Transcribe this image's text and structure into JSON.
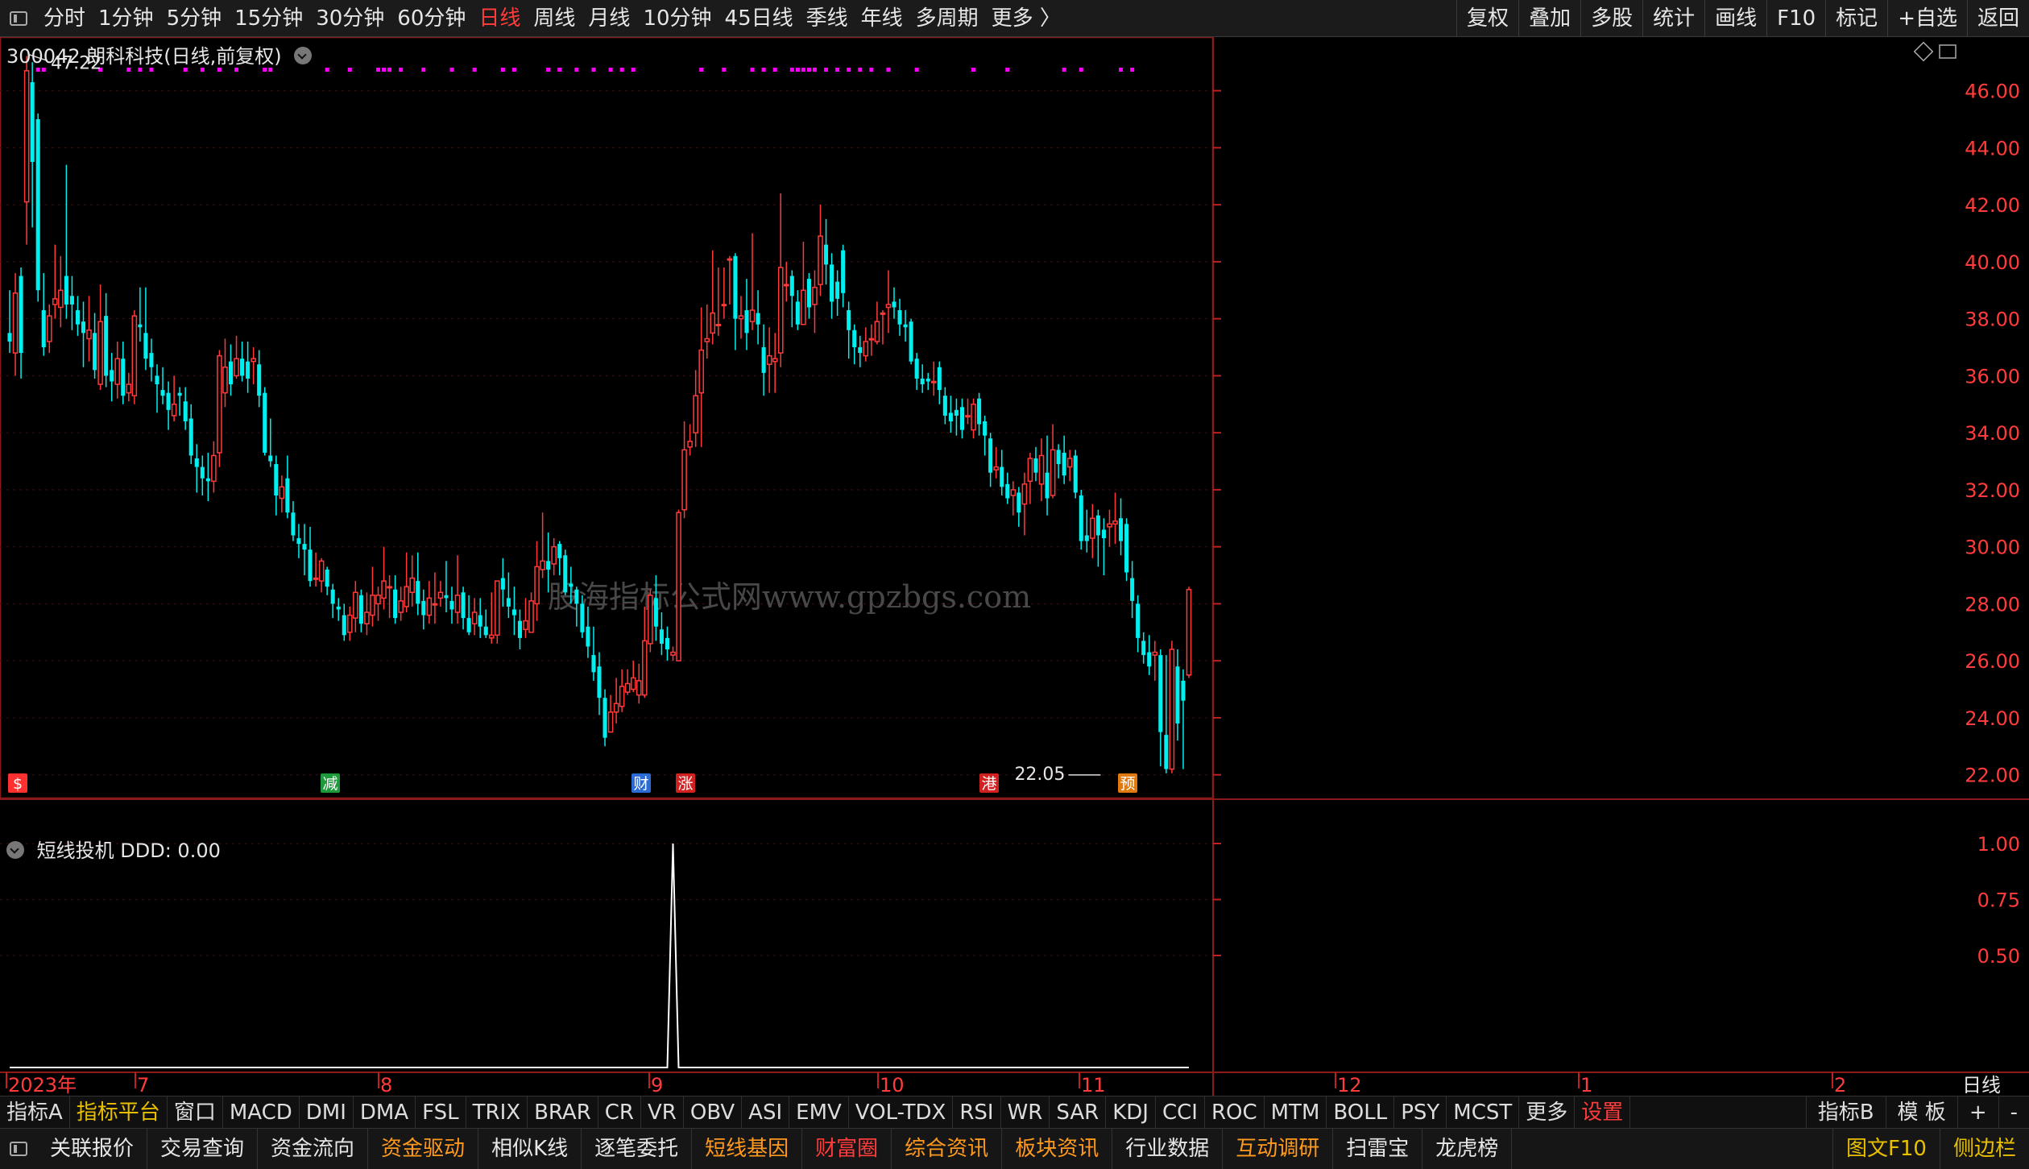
{
  "toolbar": {
    "periods": [
      "分时",
      "1分钟",
      "5分钟",
      "15分钟",
      "30分钟",
      "60分钟",
      "日线",
      "周线",
      "月线",
      "10分钟",
      "45日线",
      "季线",
      "年线",
      "多周期",
      "更多 〉"
    ],
    "active_period": "日线",
    "right_buttons": [
      "复权",
      "叠加",
      "多股",
      "统计",
      "画线",
      "F10",
      "标记",
      "+自选",
      "返回"
    ]
  },
  "chart": {
    "title": "300042 朗科科技(日线,前复权)",
    "high_label": "47.22",
    "low_label": "22.05",
    "watermark": "股海指标公式网www.gpzbgs.com",
    "price_axis": [
      "46.00",
      "44.00",
      "42.00",
      "40.00",
      "38.00",
      "36.00",
      "34.00",
      "32.00",
      "30.00",
      "28.00",
      "26.00",
      "24.00",
      "22.00"
    ],
    "event_markers": [
      {
        "label": "$",
        "color": "#ff3030"
      },
      {
        "label": "减",
        "color": "#1e9a3c"
      },
      {
        "label": "财",
        "color": "#2a6bd6"
      },
      {
        "label": "涨",
        "color": "#d02020"
      },
      {
        "label": "港",
        "color": "#d02020"
      },
      {
        "label": "预",
        "color": "#e07a10"
      }
    ],
    "up_color": "#ff3a3a",
    "down_color": "#00f0f0",
    "dots_color": "#ff00ff"
  },
  "indicator": {
    "title": "短线投机 DDD: 0.00",
    "axis": [
      "1.00",
      "0.75",
      "0.50"
    ]
  },
  "time_axis": {
    "labels": [
      "2023年",
      "7",
      "8",
      "9",
      "10",
      "11",
      "12",
      "1",
      "2"
    ],
    "period_label": "日线"
  },
  "indicator_tabs": {
    "items": [
      "指标A",
      "指标平台",
      "窗口",
      "MACD",
      "DMI",
      "DMA",
      "FSL",
      "TRIX",
      "BRAR",
      "CR",
      "VR",
      "OBV",
      "ASI",
      "EMV",
      "VOL-TDX",
      "RSI",
      "WR",
      "SAR",
      "KDJ",
      "CCI",
      "ROC",
      "MTM",
      "BOLL",
      "PSY",
      "MCST",
      "更多",
      "设置"
    ],
    "highlight_yellow": "指标平台",
    "highlight_red": "设置",
    "right": [
      "指标B",
      "模 板",
      "+",
      "-"
    ]
  },
  "bottom_bar": {
    "items": [
      "关联报价",
      "交易查询",
      "资金流向",
      "资金驱动",
      "相似K线",
      "逐笔委托",
      "短线基因",
      "财富圈",
      "综合资讯",
      "板块资讯",
      "行业数据",
      "互动调研",
      "扫雷宝",
      "龙虎榜"
    ],
    "orange": [
      "资金驱动",
      "短线基因",
      "综合资讯",
      "板块资讯",
      "互动调研"
    ],
    "red": [
      "财富圈"
    ],
    "right": [
      "图文F10",
      "侧边栏"
    ]
  },
  "chart_data": {
    "type": "candlestick",
    "price_range": [
      21.2,
      47.6
    ],
    "candles": [
      [
        37.5,
        37.2,
        39.0,
        36.8
      ],
      [
        36.8,
        38.9,
        39.6,
        36.0
      ],
      [
        39.5,
        36.8,
        39.8,
        35.9
      ],
      [
        42.1,
        46.7,
        47.22,
        40.6
      ],
      [
        46.3,
        43.5,
        47.0,
        41.2
      ],
      [
        45.0,
        39.0,
        45.2,
        38.6
      ],
      [
        38.3,
        37.0,
        39.6,
        36.7
      ],
      [
        37.2,
        38.1,
        38.5,
        36.8
      ],
      [
        38.5,
        38.7,
        40.6,
        38.0
      ],
      [
        38.4,
        39.0,
        40.2,
        37.7
      ],
      [
        39.5,
        38.5,
        43.4,
        38.0
      ],
      [
        38.8,
        38.5,
        39.5,
        37.6
      ],
      [
        38.3,
        37.8,
        38.8,
        37.4
      ],
      [
        37.9,
        37.5,
        38.6,
        36.3
      ],
      [
        37.3,
        37.6,
        38.8,
        36.5
      ],
      [
        37.5,
        36.2,
        38.2,
        35.9
      ],
      [
        35.7,
        37.9,
        39.2,
        35.5
      ],
      [
        38.1,
        36.0,
        38.9,
        35.6
      ],
      [
        36.2,
        35.8,
        36.8,
        35.1
      ],
      [
        35.7,
        36.6,
        37.2,
        35.2
      ],
      [
        36.6,
        35.3,
        37.2,
        35.0
      ],
      [
        35.4,
        35.7,
        36.1,
        35.1
      ],
      [
        35.3,
        38.1,
        38.3,
        35.0
      ],
      [
        37.8,
        37.7,
        39.1,
        37.2
      ],
      [
        37.5,
        36.6,
        39.1,
        36.2
      ],
      [
        36.8,
        36.3,
        37.3,
        35.8
      ],
      [
        36.0,
        35.7,
        36.4,
        34.7
      ],
      [
        35.5,
        35.3,
        36.3,
        35.0
      ],
      [
        35.4,
        34.8,
        35.8,
        34.1
      ],
      [
        34.6,
        35.0,
        36.0,
        34.4
      ],
      [
        35.4,
        35.3,
        35.6,
        34.6
      ],
      [
        35.1,
        34.4,
        35.6,
        34.1
      ],
      [
        34.5,
        33.2,
        35.0,
        32.9
      ],
      [
        33.1,
        32.8,
        33.6,
        31.9
      ],
      [
        32.8,
        32.4,
        33.2,
        31.8
      ],
      [
        32.4,
        32.3,
        33.3,
        31.6
      ],
      [
        32.3,
        33.2,
        33.7,
        31.9
      ],
      [
        33.3,
        36.7,
        36.9,
        32.8
      ],
      [
        35.4,
        36.3,
        37.3,
        34.9
      ],
      [
        36.5,
        35.7,
        37.1,
        35.3
      ],
      [
        36.0,
        36.6,
        37.4,
        35.9
      ],
      [
        36.6,
        36.0,
        37.2,
        35.8
      ],
      [
        36.5,
        35.9,
        37.2,
        35.4
      ],
      [
        36.5,
        36.6,
        37.0,
        35.7
      ],
      [
        36.4,
        35.3,
        36.9,
        34.9
      ],
      [
        35.4,
        33.3,
        35.6,
        33.2
      ],
      [
        33.2,
        33.0,
        34.5,
        32.8
      ],
      [
        32.9,
        31.8,
        33.2,
        31.1
      ],
      [
        31.7,
        32.1,
        32.5,
        31.2
      ],
      [
        32.4,
        31.2,
        33.2,
        31.0
      ],
      [
        31.2,
        30.4,
        31.6,
        30.2
      ],
      [
        30.3,
        30.1,
        30.8,
        29.6
      ],
      [
        30.1,
        29.9,
        30.8,
        29.0
      ],
      [
        29.9,
        28.8,
        30.7,
        28.6
      ],
      [
        28.9,
        28.9,
        29.8,
        28.6
      ],
      [
        28.8,
        29.5,
        29.6,
        28.4
      ],
      [
        29.2,
        28.6,
        29.3,
        28.3
      ],
      [
        28.5,
        28.0,
        28.7,
        27.5
      ],
      [
        27.9,
        27.8,
        28.2,
        27.4
      ],
      [
        27.6,
        26.9,
        28.0,
        26.7
      ],
      [
        27.0,
        27.6,
        27.9,
        26.7
      ],
      [
        27.5,
        28.4,
        28.8,
        27.0
      ],
      [
        28.3,
        27.3,
        28.5,
        27.0
      ],
      [
        27.3,
        27.7,
        28.4,
        26.9
      ],
      [
        27.6,
        28.3,
        29.3,
        27.2
      ],
      [
        28.0,
        28.3,
        28.6,
        27.4
      ],
      [
        28.2,
        28.8,
        30.0,
        27.8
      ],
      [
        28.6,
        28.6,
        29.0,
        27.5
      ],
      [
        28.5,
        27.5,
        29.0,
        27.3
      ],
      [
        27.7,
        28.1,
        28.6,
        27.4
      ],
      [
        27.9,
        28.6,
        29.8,
        27.7
      ],
      [
        28.4,
        28.9,
        29.7,
        27.9
      ],
      [
        28.8,
        28.0,
        29.8,
        27.6
      ],
      [
        28.1,
        27.6,
        28.5,
        27.1
      ],
      [
        27.6,
        28.2,
        28.8,
        27.3
      ],
      [
        28.0,
        28.0,
        29.1,
        27.3
      ],
      [
        28.2,
        28.4,
        28.8,
        27.9
      ],
      [
        28.3,
        28.2,
        29.5,
        27.7
      ],
      [
        28.1,
        27.8,
        28.6,
        27.3
      ],
      [
        27.7,
        28.3,
        29.7,
        27.3
      ],
      [
        28.4,
        27.5,
        28.6,
        27.1
      ],
      [
        27.5,
        27.0,
        28.3,
        26.9
      ],
      [
        27.3,
        27.7,
        28.2,
        26.9
      ],
      [
        27.6,
        27.2,
        28.2,
        26.8
      ],
      [
        27.2,
        26.9,
        27.8,
        26.8
      ],
      [
        26.8,
        26.9,
        28.4,
        26.6
      ],
      [
        26.9,
        28.8,
        28.8,
        26.6
      ],
      [
        28.9,
        28.5,
        29.6,
        27.9
      ],
      [
        28.2,
        27.9,
        29.1,
        27.5
      ],
      [
        27.8,
        27.6,
        28.6,
        26.9
      ],
      [
        27.4,
        26.8,
        27.8,
        26.4
      ],
      [
        27.1,
        27.4,
        28.2,
        26.8
      ],
      [
        27.0,
        28.1,
        28.4,
        27.4
      ],
      [
        28.0,
        29.3,
        30.2,
        27.4
      ],
      [
        29.2,
        29.5,
        31.2,
        28.9
      ],
      [
        29.5,
        29.2,
        30.5,
        28.4
      ],
      [
        29.4,
        30.0,
        30.3,
        29.0
      ],
      [
        30.1,
        29.6,
        30.2,
        29.0
      ],
      [
        29.7,
        28.4,
        29.9,
        28.3
      ],
      [
        28.7,
        28.6,
        29.3,
        28.0
      ],
      [
        28.5,
        28.0,
        28.6,
        27.2
      ],
      [
        28.0,
        27.0,
        28.3,
        26.8
      ],
      [
        27.2,
        26.5,
        27.9,
        26.1
      ],
      [
        26.2,
        25.6,
        27.2,
        25.3
      ],
      [
        25.8,
        24.7,
        26.3,
        24.1
      ],
      [
        24.7,
        23.3,
        25.0,
        23.0
      ],
      [
        23.5,
        24.2,
        24.8,
        23.5
      ],
      [
        24.2,
        24.5,
        25.4,
        23.8
      ],
      [
        24.4,
        25.1,
        25.7,
        24.2
      ],
      [
        24.9,
        25.2,
        25.7,
        24.8
      ],
      [
        25.0,
        25.4,
        26.0,
        24.9
      ],
      [
        24.8,
        25.3,
        25.9,
        24.5
      ],
      [
        24.8,
        26.7,
        27.9,
        24.7
      ],
      [
        26.6,
        28.3,
        28.5,
        26.3
      ],
      [
        28.2,
        27.2,
        29.0,
        26.7
      ],
      [
        27.1,
        26.6,
        27.7,
        26.2
      ],
      [
        26.8,
        26.4,
        27.2,
        26.0
      ],
      [
        26.2,
        26.3,
        26.5,
        26.0
      ],
      [
        26.0,
        31.2,
        31.3,
        26.0
      ],
      [
        31.3,
        33.4,
        34.4,
        31.0
      ],
      [
        33.5,
        33.7,
        34.3,
        33.2
      ],
      [
        34.0,
        35.3,
        36.2,
        33.5
      ],
      [
        35.4,
        36.9,
        38.4,
        33.5
      ],
      [
        37.2,
        37.3,
        38.5,
        36.6
      ],
      [
        37.5,
        38.2,
        40.4,
        37.1
      ],
      [
        37.8,
        37.8,
        39.8,
        37.4
      ],
      [
        38.5,
        38.5,
        39.8,
        38.0
      ],
      [
        40.1,
        40.1,
        40.2,
        38.5
      ],
      [
        40.2,
        38.0,
        40.3,
        36.9
      ],
      [
        38.0,
        38.1,
        38.8,
        37.3
      ],
      [
        38.3,
        37.5,
        39.4,
        36.9
      ],
      [
        37.9,
        38.3,
        41.0,
        37.6
      ],
      [
        38.2,
        37.8,
        39.0,
        37.1
      ],
      [
        37.0,
        36.1,
        37.8,
        35.3
      ],
      [
        36.4,
        36.7,
        37.7,
        35.4
      ],
      [
        36.5,
        36.6,
        37.5,
        35.4
      ],
      [
        36.8,
        39.8,
        42.4,
        36.3
      ],
      [
        39.2,
        39.2,
        40.0,
        38.6
      ],
      [
        39.5,
        38.8,
        39.7,
        37.7
      ],
      [
        38.6,
        37.8,
        39.0,
        37.6
      ],
      [
        37.8,
        39.0,
        40.7,
        37.9
      ],
      [
        39.4,
        38.4,
        39.6,
        38.0
      ],
      [
        38.5,
        39.1,
        39.7,
        37.5
      ],
      [
        39.2,
        40.9,
        42.0,
        38.8
      ],
      [
        40.6,
        39.9,
        41.5,
        39.2
      ],
      [
        39.9,
        38.6,
        40.3,
        38.0
      ],
      [
        39.3,
        38.7,
        39.7,
        38.1
      ],
      [
        40.4,
        38.9,
        40.6,
        38.4
      ],
      [
        38.3,
        37.6,
        38.6,
        36.6
      ],
      [
        37.6,
        37.0,
        37.8,
        36.4
      ],
      [
        37.0,
        36.8,
        37.4,
        36.3
      ],
      [
        36.7,
        37.2,
        37.7,
        36.5
      ],
      [
        37.3,
        37.3,
        37.8,
        36.7
      ],
      [
        37.2,
        37.9,
        38.6,
        37.1
      ],
      [
        38.2,
        38.2,
        38.3,
        37.1
      ],
      [
        38.4,
        38.5,
        39.7,
        37.5
      ],
      [
        38.6,
        38.4,
        39.1,
        38.0
      ],
      [
        38.3,
        37.8,
        38.7,
        37.4
      ],
      [
        37.8,
        37.7,
        38.3,
        37.2
      ],
      [
        37.9,
        36.5,
        38.0,
        36.4
      ],
      [
        36.6,
        35.9,
        36.8,
        35.5
      ],
      [
        35.9,
        35.7,
        36.4,
        35.4
      ],
      [
        35.9,
        35.8,
        36.1,
        35.5
      ],
      [
        35.8,
        35.8,
        36.5,
        35.3
      ],
      [
        36.3,
        35.5,
        36.5,
        35.0
      ],
      [
        35.3,
        34.6,
        35.6,
        34.3
      ],
      [
        34.7,
        34.4,
        35.3,
        34.0
      ],
      [
        34.8,
        34.6,
        35.2,
        33.9
      ],
      [
        34.9,
        34.1,
        35.2,
        33.8
      ],
      [
        34.6,
        34.6,
        35.2,
        34.3
      ],
      [
        34.1,
        35.0,
        35.2,
        33.8
      ],
      [
        35.2,
        34.3,
        35.4,
        33.9
      ],
      [
        34.4,
        33.9,
        34.6,
        33.2
      ],
      [
        33.8,
        32.6,
        34.0,
        32.1
      ],
      [
        32.7,
        32.8,
        33.5,
        32.4
      ],
      [
        32.8,
        32.1,
        33.4,
        31.8
      ],
      [
        32.2,
        31.7,
        32.6,
        31.5
      ],
      [
        31.8,
        32.0,
        32.3,
        31.1
      ],
      [
        31.9,
        31.2,
        32.1,
        30.7
      ],
      [
        31.5,
        32.2,
        32.6,
        30.4
      ],
      [
        32.3,
        33.1,
        33.3,
        31.5
      ],
      [
        33.1,
        32.6,
        33.5,
        32.3
      ],
      [
        32.2,
        33.2,
        33.8,
        31.6
      ],
      [
        32.6,
        31.7,
        33.9,
        31.1
      ],
      [
        31.8,
        33.4,
        34.3,
        31.7
      ],
      [
        33.4,
        32.9,
        33.6,
        32.4
      ],
      [
        33.3,
        32.5,
        33.9,
        32.2
      ],
      [
        32.8,
        33.1,
        33.4,
        32.3
      ],
      [
        33.2,
        31.9,
        33.4,
        31.7
      ],
      [
        31.8,
        30.2,
        32.0,
        29.9
      ],
      [
        30.4,
        30.2,
        31.3,
        29.8
      ],
      [
        30.3,
        31.0,
        31.5,
        29.6
      ],
      [
        31.1,
        30.4,
        31.3,
        29.3
      ],
      [
        30.6,
        30.3,
        31.0,
        29.0
      ],
      [
        30.7,
        30.8,
        31.3,
        30.0
      ],
      [
        30.8,
        30.9,
        31.9,
        30.1
      ],
      [
        31.0,
        30.2,
        31.7,
        29.7
      ],
      [
        30.8,
        29.1,
        31.0,
        28.8
      ],
      [
        28.9,
        28.1,
        29.5,
        27.5
      ],
      [
        28.0,
        26.8,
        28.3,
        26.3
      ],
      [
        26.7,
        26.2,
        27.0,
        25.9
      ],
      [
        26.3,
        25.8,
        26.9,
        25.5
      ],
      [
        26.2,
        26.3,
        26.7,
        25.3
      ],
      [
        26.2,
        23.5,
        26.4,
        22.3
      ],
      [
        23.4,
        22.2,
        26.2,
        22.05
      ],
      [
        22.2,
        26.4,
        26.7,
        22.05
      ],
      [
        25.8,
        23.8,
        26.4,
        23.2
      ],
      [
        25.3,
        24.6,
        25.7,
        22.2
      ],
      [
        25.5,
        28.5,
        28.6,
        25.4
      ]
    ],
    "indicator_series": {
      "name": "DDD",
      "range": [
        0,
        1
      ],
      "spike_index": 117,
      "spike_value": 1.0
    }
  }
}
